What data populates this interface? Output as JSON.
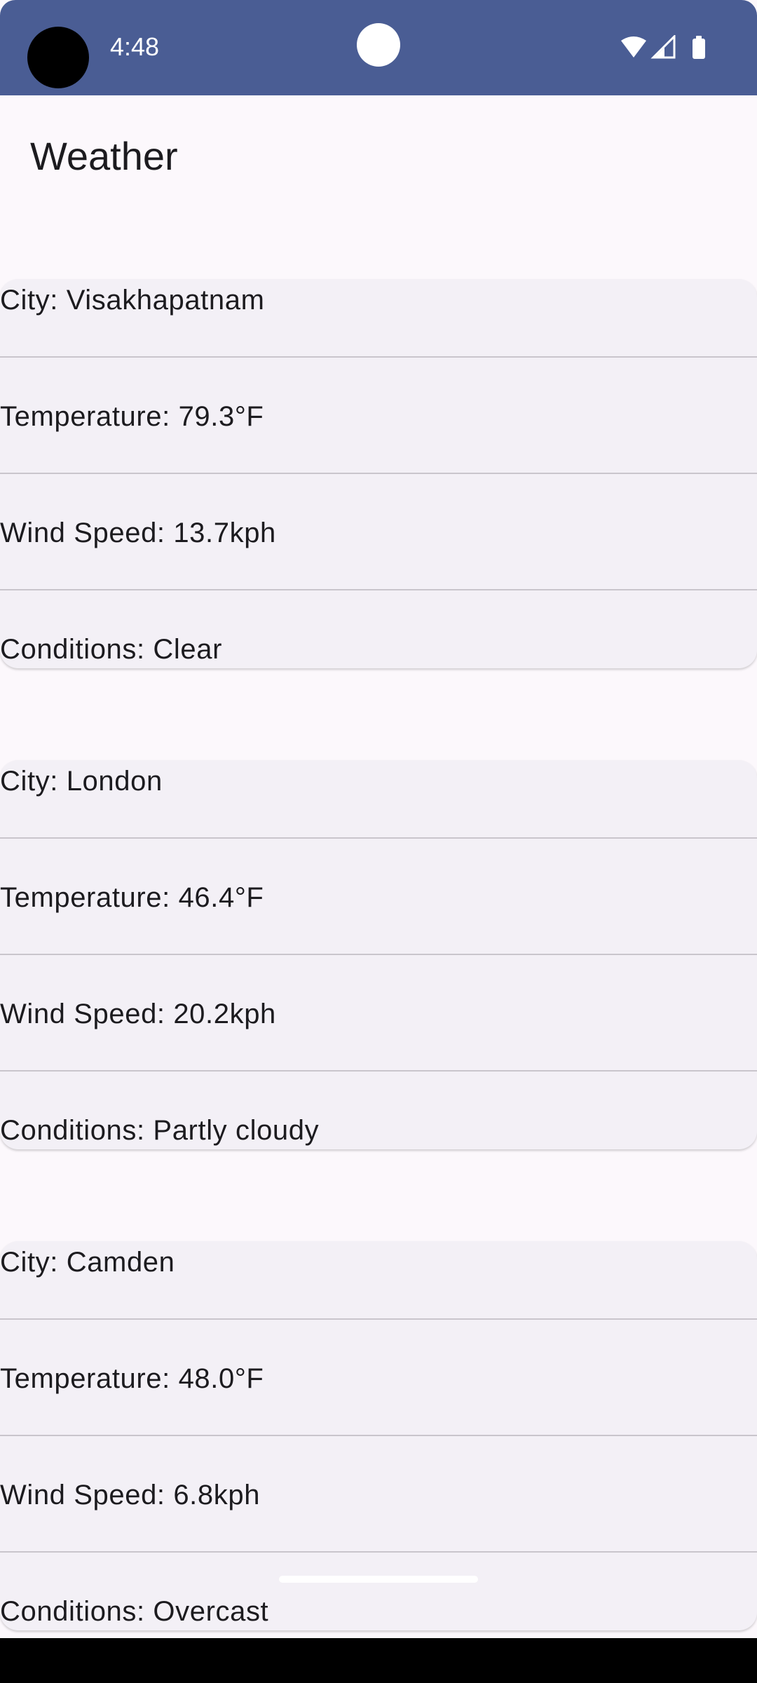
{
  "status_bar": {
    "time": "4:48",
    "icons": [
      "wifi-icon",
      "signal-icon",
      "battery-icon"
    ],
    "background": "#4a5d94"
  },
  "app": {
    "title": "Weather"
  },
  "cities": [
    {
      "city": "City: Visakhapatnam",
      "temperature": "Temperature: 79.3°F",
      "wind": "Wind Speed: 13.7kph",
      "conditions": "Conditions: Clear"
    },
    {
      "city": "City: London",
      "temperature": "Temperature: 46.4°F",
      "wind": "Wind Speed: 20.2kph",
      "conditions": "Conditions: Partly cloudy"
    },
    {
      "city": "City: Camden",
      "temperature": "Temperature: 48.0°F",
      "wind": "Wind Speed: 6.8kph",
      "conditions": "Conditions: Overcast"
    }
  ],
  "colors": {
    "background": "#fcf8fc",
    "card": "#f3f0f6",
    "divider": "#c9c5cc",
    "text": "#1c1b1f"
  }
}
